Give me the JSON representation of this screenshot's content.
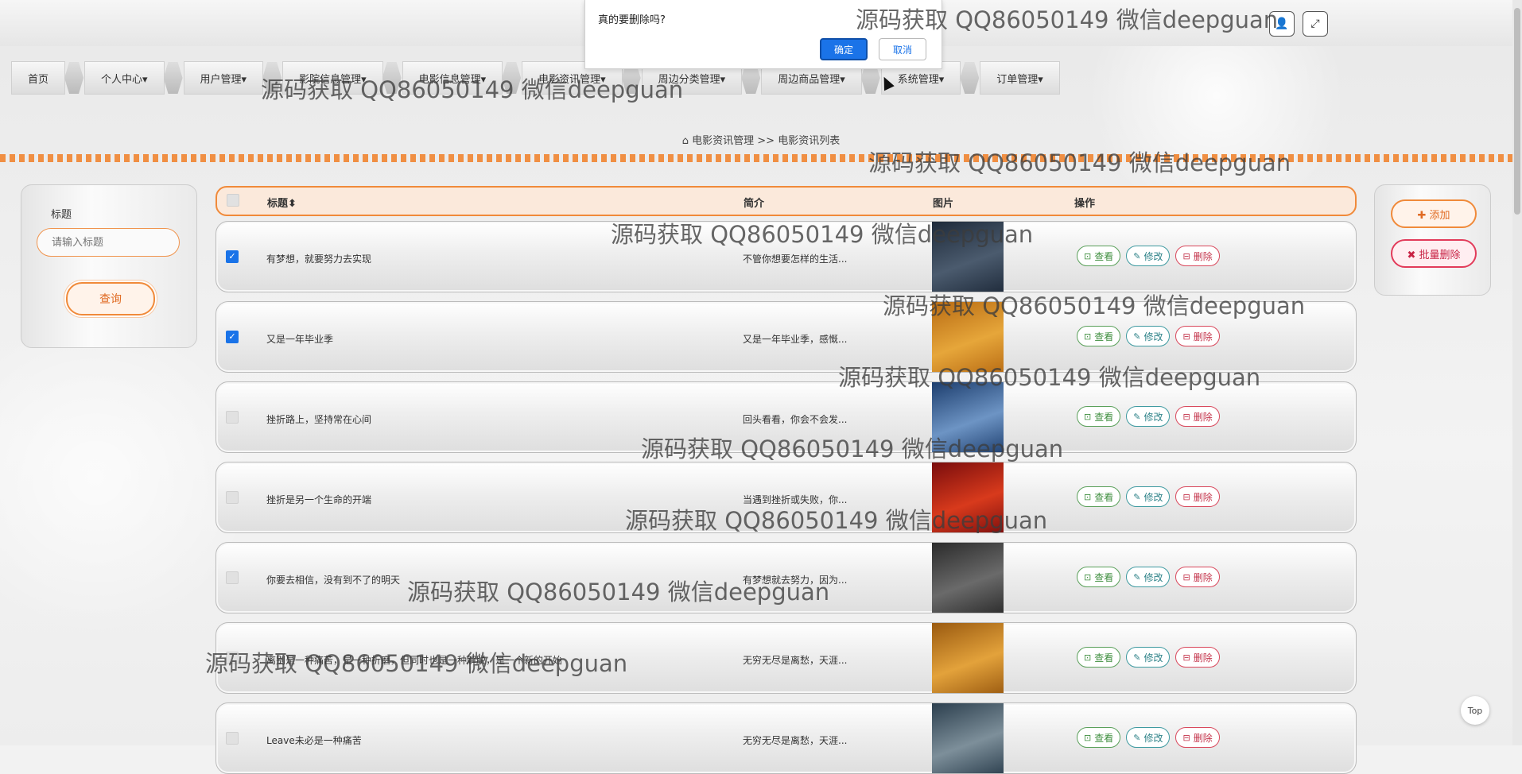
{
  "nav": {
    "items": [
      "首页",
      "个人中心▾",
      "用户管理▾",
      "影院信息管理▾",
      "电影信息管理▾",
      "电影资讯管理▾",
      "周边分类管理▾",
      "周边商品管理▾",
      "系统管理▾",
      "订单管理▾"
    ]
  },
  "breadcrumb": {
    "home_icon": "home-icon",
    "path": "电影资讯管理 >> 电影资讯列表"
  },
  "search": {
    "label": "标题",
    "placeholder": "请输入标题",
    "button": "查询"
  },
  "actions": {
    "add": "✚ 添加",
    "batch_delete": "✖ 批量删除"
  },
  "table": {
    "headers": {
      "title": "标题⬍",
      "intro": "简介",
      "image": "图片",
      "ops": "操作"
    },
    "rows": [
      {
        "checked": true,
        "title": "有梦想，就要努力去实现",
        "intro": "不管你想要怎样的生活...",
        "poster_colors": [
          "#1e2a3a",
          "#4b5b6e"
        ]
      },
      {
        "checked": true,
        "title": "又是一年毕业季",
        "intro": "又是一年毕业季，感慨...",
        "poster_colors": [
          "#b86b13",
          "#e6a63a"
        ]
      },
      {
        "checked": false,
        "title": "挫折路上，坚持常在心间",
        "intro": "回头看看，你会不会发...",
        "poster_colors": [
          "#1d3e6e",
          "#6d94c4"
        ]
      },
      {
        "checked": false,
        "title": "挫折是另一个生命的开端",
        "intro": "当遇到挫折或失败，你...",
        "poster_colors": [
          "#7a0d0d",
          "#d83a1c"
        ]
      },
      {
        "checked": false,
        "title": "你要去相信，没有到不了的明天",
        "intro": "有梦想就去努力，因为...",
        "poster_colors": [
          "#2b2b2b",
          "#6a6a6a"
        ]
      },
      {
        "checked": false,
        "title": "离别是一种痛苦，是一种折磨，但同时也是一种解脱，是一个新的开始",
        "intro": "无穷无尽是离愁，天涯...",
        "poster_colors": [
          "#9a5a10",
          "#e3a23b"
        ]
      },
      {
        "checked": false,
        "title": "Leave未必是一种痛苦",
        "intro": "无穷无尽是离愁，天涯...",
        "poster_colors": [
          "#2c3f4e",
          "#7d8f9a"
        ]
      }
    ],
    "op_labels": {
      "view": "查看",
      "edit": "修改",
      "delete": "删除"
    }
  },
  "dialog": {
    "message": "真的要删除吗?",
    "ok": "确定",
    "cancel": "取消"
  },
  "watermark": "源码获取 QQ86050149 微信deepguan",
  "top_button": "Top",
  "colors": {
    "accent": "#f08a3a",
    "danger": "#d9485c",
    "view": "#5aa05a",
    "edit": "#3e9aa0",
    "primary": "#1a73e8"
  }
}
